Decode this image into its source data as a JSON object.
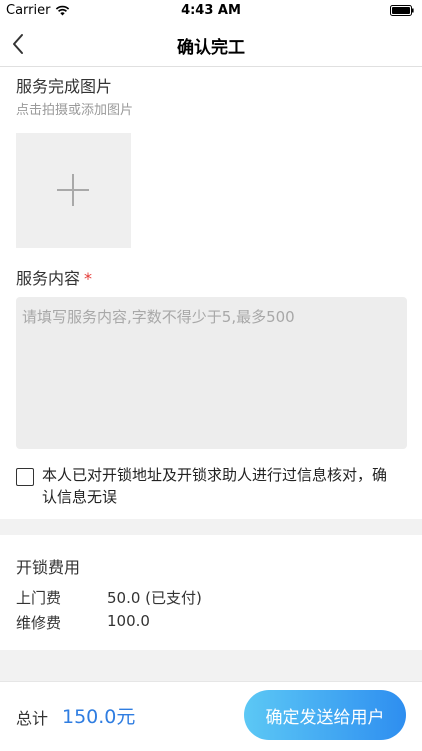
{
  "status_bar": {
    "carrier": "Carrier",
    "time": "4:43 AM"
  },
  "nav": {
    "title": "确认完工"
  },
  "photos": {
    "title": "服务完成图片",
    "hint": "点击拍摄或添加图片"
  },
  "service_content": {
    "title": "服务内容",
    "required_mark": "*",
    "placeholder": "请填写服务内容,字数不得少于5,最多500"
  },
  "agreement": {
    "text": "本人已对开锁地址及开锁求助人进行过信息核对，确认信息无误",
    "checked": false
  },
  "fees": {
    "title": "开锁费用",
    "items": [
      {
        "label": "上门费",
        "value": "50.0 (已支付)"
      },
      {
        "label": "维修费",
        "value": "100.0"
      }
    ]
  },
  "footer": {
    "total_label": "总计",
    "total_value": "150.0元",
    "submit_label": "确定发送给用户"
  },
  "colors": {
    "accent": "#2f7de1",
    "required": "#e53935"
  }
}
